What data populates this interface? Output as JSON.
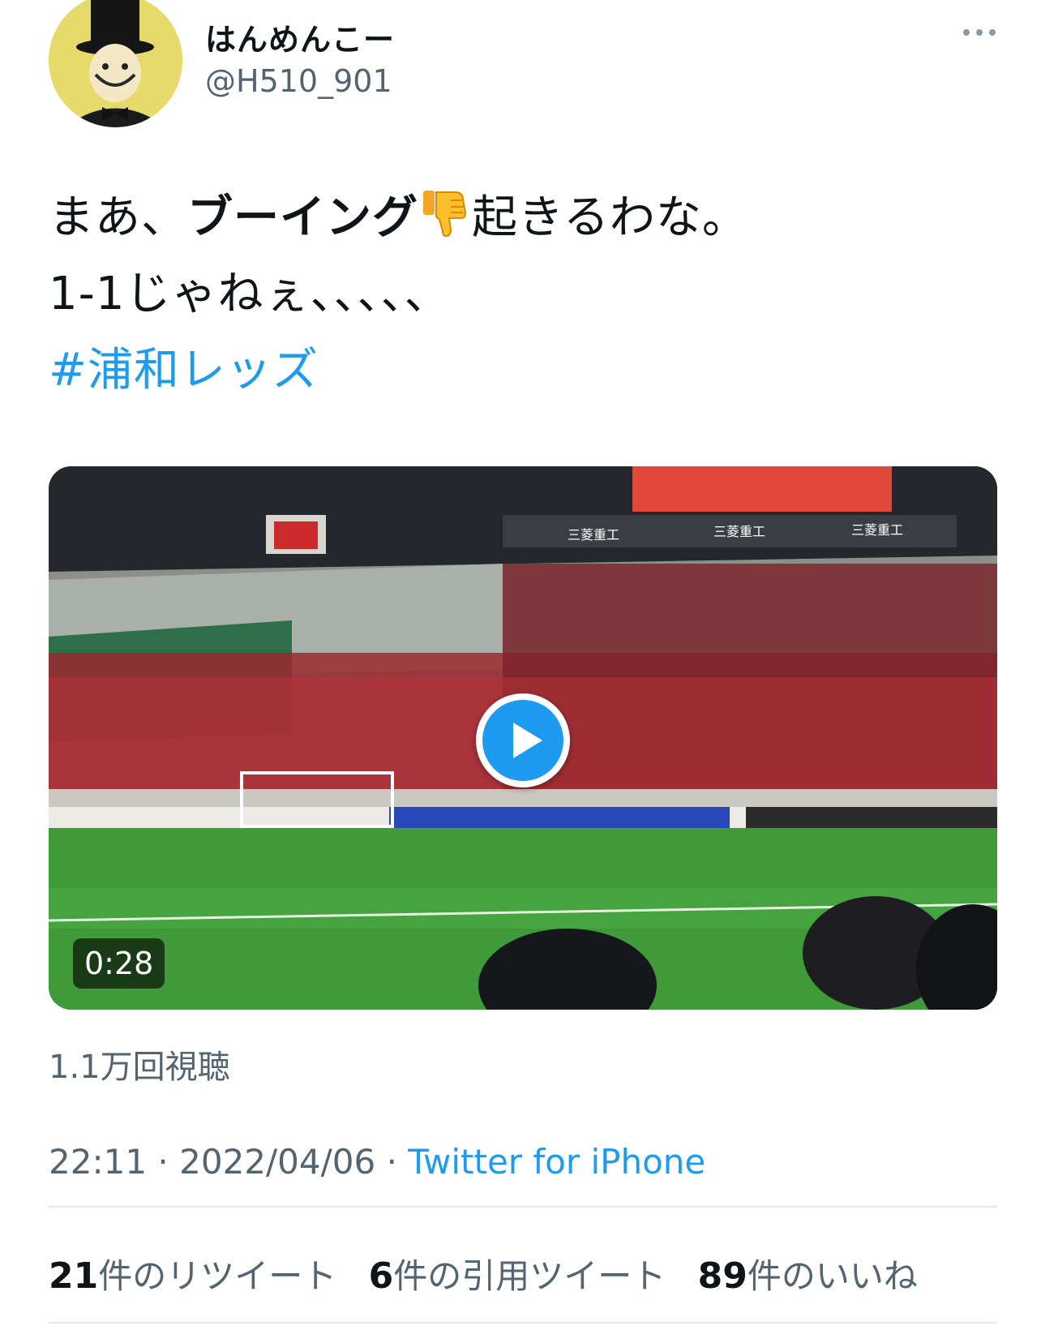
{
  "user": {
    "display_name": "はんめんこー",
    "handle": "@H510_901"
  },
  "tweet": {
    "line1_pre": "まあ、",
    "line1_bold": "ブーイング",
    "line1_emoji": "thumbs-down-emoji",
    "line1_post": "起きるわな。",
    "line2": "1-1じゃねぇ、、、、、",
    "hashtag": "#浦和レッズ"
  },
  "media": {
    "board_text": "三菱重工",
    "duration": "0:28"
  },
  "views": "1.1万回視聴",
  "meta": {
    "time": "22:11",
    "separator": "·",
    "date": "2022/04/06",
    "source": "Twitter for iPhone"
  },
  "stats": {
    "retweets_count": "21",
    "retweets_label": "件のリツイート",
    "quotes_count": "6",
    "quotes_label": "件の引用ツイート",
    "likes_count": "89",
    "likes_label": "件のいいね"
  },
  "colors": {
    "accent": "#1d9bf0",
    "secondary_text": "#536471",
    "text": "#0f1419"
  }
}
